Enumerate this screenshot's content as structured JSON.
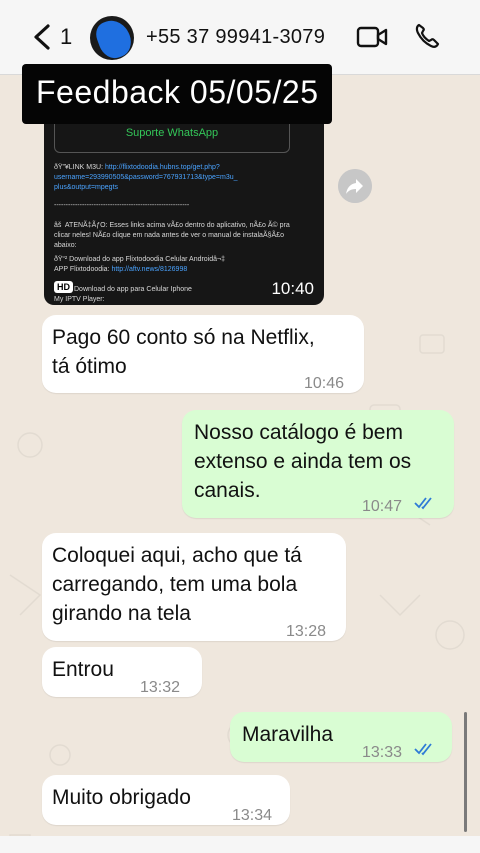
{
  "header": {
    "unread_count": "1",
    "contact_number": "+55 37 99941-3079"
  },
  "overlay_title": "Feedback 05/05/25",
  "media": {
    "button_label": "Suporte WhatsApp",
    "lines": [
      "ðŸ”¥LINK M3U: ",
      "username=293990505&password=767931713&type=m3u_",
      "plus&output=mpegts",
      "----------------------------------------------------------",
      "âš  ATENÃ‡ÃƒO: Esses links acima vÃ£o dentro do aplicativo, nÃ£o Ã© pra",
      "clicar neles! NÃ£o clique em nada antes de ver o manual de instalaÃ§Ã£o",
      "abaixo:",
      "ðŸ“² Download do app Flixtodoodia Celular Androidâ¬‡",
      "APP Flixtodoodia: ",
      "Download do app para Celular Iphone",
      "My IPTV Player: "
    ],
    "link_1": "http://flixtodoodia.hubns.top/get.php?",
    "link_2": "http://aftv.news/8126998",
    "hd_badge": "HD",
    "time": "10:40"
  },
  "messages": [
    {
      "dir": "in",
      "lines": [
        "Pago 60 conto só na Netflix,",
        "tá ótimo"
      ],
      "time": "10:46"
    },
    {
      "dir": "out",
      "lines": [
        "Nosso catálogo é bem",
        "extenso e ainda tem os",
        "canais."
      ],
      "time": "10:47"
    },
    {
      "dir": "in",
      "lines": [
        "Coloquei aqui, acho que tá",
        "carregando, tem uma bola",
        "girando na tela"
      ],
      "time": "13:28"
    },
    {
      "dir": "in",
      "lines": [
        "Entrou"
      ],
      "time": "13:32"
    },
    {
      "dir": "out",
      "lines": [
        "Maravilha"
      ],
      "time": "13:33"
    },
    {
      "dir": "in",
      "lines": [
        "Muito obrigado"
      ],
      "time": "13:34"
    }
  ],
  "colors": {
    "incoming_bubble": "#ffffff",
    "outgoing_bubble": "#d9fdd3",
    "read_check": "#2f7bd6",
    "wallpaper": "#efe7dd"
  },
  "icons": [
    "back-chevron-icon",
    "avatar-image",
    "video-call-icon",
    "phone-call-icon",
    "forward-icon",
    "double-check-icon"
  ]
}
